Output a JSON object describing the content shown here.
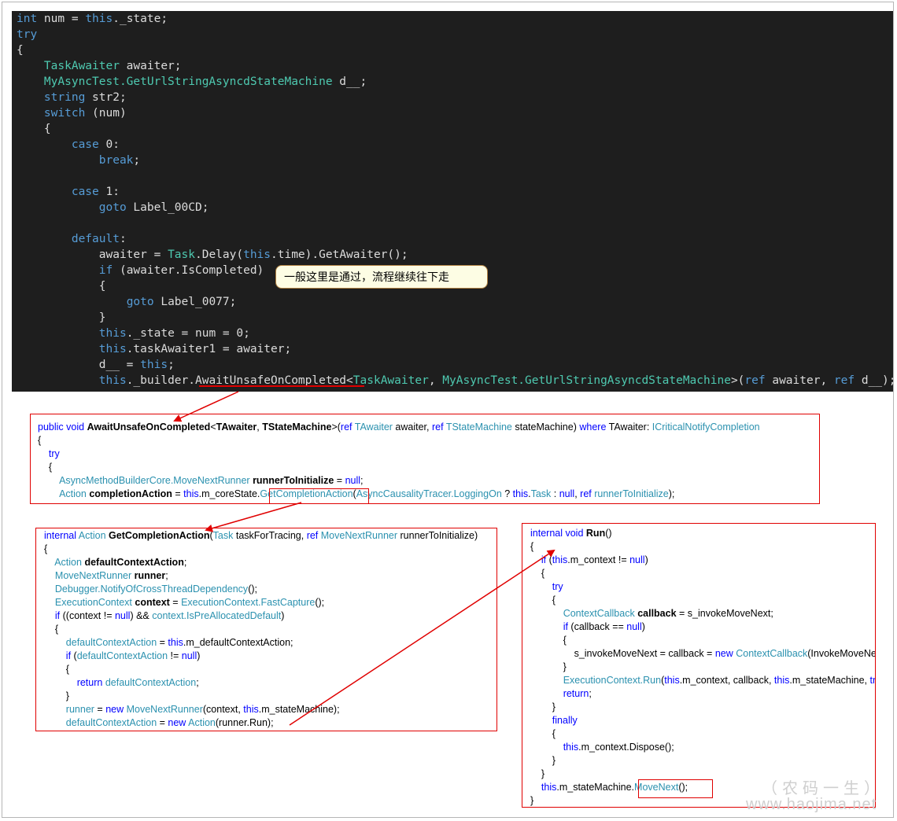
{
  "main_code": {
    "lines": [
      [
        {
          "t": "int",
          "c": "kw"
        },
        {
          "t": " num = "
        },
        {
          "t": "this",
          "c": "kw"
        },
        {
          "t": "._state;"
        }
      ],
      [
        {
          "t": "try",
          "c": "kw"
        }
      ],
      [
        {
          "t": "{"
        }
      ],
      [
        {
          "t": "    "
        },
        {
          "t": "TaskAwaiter",
          "c": "ty"
        },
        {
          "t": " awaiter;"
        }
      ],
      [
        {
          "t": "    "
        },
        {
          "t": "MyAsyncTest.GetUrlStringAsyncdStateMachine",
          "c": "ty"
        },
        {
          "t": " d__;"
        }
      ],
      [
        {
          "t": "    "
        },
        {
          "t": "string",
          "c": "kw"
        },
        {
          "t": " str2;"
        }
      ],
      [
        {
          "t": "    "
        },
        {
          "t": "switch",
          "c": "kw"
        },
        {
          "t": " (num)"
        }
      ],
      [
        {
          "t": "    {"
        }
      ],
      [
        {
          "t": "        "
        },
        {
          "t": "case",
          "c": "kw"
        },
        {
          "t": " 0:"
        }
      ],
      [
        {
          "t": "            "
        },
        {
          "t": "break",
          "c": "kw"
        },
        {
          "t": ";"
        }
      ],
      [
        {
          "t": ""
        }
      ],
      [
        {
          "t": "        "
        },
        {
          "t": "case",
          "c": "kw"
        },
        {
          "t": " 1:"
        }
      ],
      [
        {
          "t": "            "
        },
        {
          "t": "goto",
          "c": "kw"
        },
        {
          "t": " Label_00CD;"
        }
      ],
      [
        {
          "t": ""
        }
      ],
      [
        {
          "t": "        "
        },
        {
          "t": "default",
          "c": "kw"
        },
        {
          "t": ":"
        }
      ],
      [
        {
          "t": "            awaiter = "
        },
        {
          "t": "Task",
          "c": "ty"
        },
        {
          "t": ".Delay("
        },
        {
          "t": "this",
          "c": "kw"
        },
        {
          "t": ".time).GetAwaiter();"
        }
      ],
      [
        {
          "t": "            "
        },
        {
          "t": "if",
          "c": "kw"
        },
        {
          "t": " (awaiter.IsCompleted)"
        }
      ],
      [
        {
          "t": "            {"
        }
      ],
      [
        {
          "t": "                "
        },
        {
          "t": "goto",
          "c": "kw"
        },
        {
          "t": " Label_0077;"
        }
      ],
      [
        {
          "t": "            }"
        }
      ],
      [
        {
          "t": "            "
        },
        {
          "t": "this",
          "c": "kw"
        },
        {
          "t": "._state = num = 0;"
        }
      ],
      [
        {
          "t": "            "
        },
        {
          "t": "this",
          "c": "kw"
        },
        {
          "t": ".taskAwaiter1 = awaiter;"
        }
      ],
      [
        {
          "t": "            d__ = "
        },
        {
          "t": "this",
          "c": "kw"
        },
        {
          "t": ";"
        }
      ],
      [
        {
          "t": "            "
        },
        {
          "t": "this",
          "c": "kw"
        },
        {
          "t": "._builder.AwaitUnsafeOnCompleted<"
        },
        {
          "t": "TaskAwaiter",
          "c": "ty"
        },
        {
          "t": ", "
        },
        {
          "t": "MyAsyncTest.GetUrlStringAsyncdStateMachine",
          "c": "ty"
        },
        {
          "t": ">("
        },
        {
          "t": "ref",
          "c": "kw"
        },
        {
          "t": " awaiter, "
        },
        {
          "t": "ref",
          "c": "kw"
        },
        {
          "t": " d__);"
        }
      ]
    ]
  },
  "callout": {
    "text": "一般这里是通过，流程继续往下走"
  },
  "box_await": {
    "lines": [
      [
        {
          "t": "public",
          "c": "k"
        },
        {
          "t": " "
        },
        {
          "t": "void",
          "c": "k"
        },
        {
          "t": " "
        },
        {
          "t": "AwaitUnsafeOnCompleted",
          "c": "b"
        },
        {
          "t": "<"
        },
        {
          "t": "TAwaiter",
          "c": "b"
        },
        {
          "t": ", "
        },
        {
          "t": "TStateMachine",
          "c": "b"
        },
        {
          "t": ">("
        },
        {
          "t": "ref",
          "c": "k"
        },
        {
          "t": " "
        },
        {
          "t": "TAwaiter",
          "c": "t"
        },
        {
          "t": " awaiter, "
        },
        {
          "t": "ref",
          "c": "k"
        },
        {
          "t": " "
        },
        {
          "t": "TStateMachine",
          "c": "t"
        },
        {
          "t": " stateMachine) "
        },
        {
          "t": "where",
          "c": "k"
        },
        {
          "t": " TAwaiter: "
        },
        {
          "t": "ICriticalNotifyCompletion",
          "c": "t"
        }
      ],
      [
        {
          "t": "{"
        }
      ],
      [
        {
          "t": "    "
        },
        {
          "t": "try",
          "c": "k"
        }
      ],
      [
        {
          "t": "    {"
        }
      ],
      [
        {
          "t": "        "
        },
        {
          "t": "AsyncMethodBuilderCore.MoveNextRunner",
          "c": "t"
        },
        {
          "t": " "
        },
        {
          "t": "runnerToInitialize",
          "c": "b"
        },
        {
          "t": " = "
        },
        {
          "t": "null",
          "c": "k"
        },
        {
          "t": ";"
        }
      ],
      [
        {
          "t": "        "
        },
        {
          "t": "Action",
          "c": "t"
        },
        {
          "t": " "
        },
        {
          "t": "completionAction",
          "c": "b"
        },
        {
          "t": " = "
        },
        {
          "t": "this",
          "c": "k"
        },
        {
          "t": ".m_coreState."
        },
        {
          "t": "GetCompletionAction",
          "c": "t"
        },
        {
          "t": "("
        },
        {
          "t": "AsyncCausalityTracer.LoggingOn",
          "c": "t"
        },
        {
          "t": " ? "
        },
        {
          "t": "this",
          "c": "k"
        },
        {
          "t": "."
        },
        {
          "t": "Task",
          "c": "t"
        },
        {
          "t": " : "
        },
        {
          "t": "null",
          "c": "k"
        },
        {
          "t": ", "
        },
        {
          "t": "ref",
          "c": "k"
        },
        {
          "t": " "
        },
        {
          "t": "runnerToInitialize",
          "c": "t"
        },
        {
          "t": ");"
        }
      ]
    ]
  },
  "box_getcompletion": {
    "lines": [
      [
        {
          "t": "internal",
          "c": "k"
        },
        {
          "t": " "
        },
        {
          "t": "Action",
          "c": "t"
        },
        {
          "t": " "
        },
        {
          "t": "GetCompletionAction",
          "c": "b"
        },
        {
          "t": "("
        },
        {
          "t": "Task",
          "c": "t"
        },
        {
          "t": " taskForTracing, "
        },
        {
          "t": "ref",
          "c": "k"
        },
        {
          "t": " "
        },
        {
          "t": "MoveNextRunner",
          "c": "t"
        },
        {
          "t": " runnerToInitialize)"
        }
      ],
      [
        {
          "t": "{"
        }
      ],
      [
        {
          "t": "    "
        },
        {
          "t": "Action",
          "c": "t"
        },
        {
          "t": " "
        },
        {
          "t": "defaultContextAction",
          "c": "b"
        },
        {
          "t": ";"
        }
      ],
      [
        {
          "t": "    "
        },
        {
          "t": "MoveNextRunner",
          "c": "t"
        },
        {
          "t": " "
        },
        {
          "t": "runner",
          "c": "b"
        },
        {
          "t": ";"
        }
      ],
      [
        {
          "t": "    "
        },
        {
          "t": "Debugger.NotifyOfCrossThreadDependency",
          "c": "t"
        },
        {
          "t": "();"
        }
      ],
      [
        {
          "t": "    "
        },
        {
          "t": "ExecutionContext",
          "c": "t"
        },
        {
          "t": " "
        },
        {
          "t": "context",
          "c": "b"
        },
        {
          "t": " = "
        },
        {
          "t": "ExecutionContext.FastCapture",
          "c": "t"
        },
        {
          "t": "();"
        }
      ],
      [
        {
          "t": "    "
        },
        {
          "t": "if",
          "c": "k"
        },
        {
          "t": " ((context != "
        },
        {
          "t": "null",
          "c": "k"
        },
        {
          "t": ") && "
        },
        {
          "t": "context.IsPreAllocatedDefault",
          "c": "t"
        },
        {
          "t": ")"
        }
      ],
      [
        {
          "t": "    {"
        }
      ],
      [
        {
          "t": "        "
        },
        {
          "t": "defaultContextAction",
          "c": "t"
        },
        {
          "t": " = "
        },
        {
          "t": "this",
          "c": "k"
        },
        {
          "t": ".m_defaultContextAction;"
        }
      ],
      [
        {
          "t": "        "
        },
        {
          "t": "if",
          "c": "k"
        },
        {
          "t": " ("
        },
        {
          "t": "defaultContextAction",
          "c": "t"
        },
        {
          "t": " != "
        },
        {
          "t": "null",
          "c": "k"
        },
        {
          "t": ")"
        }
      ],
      [
        {
          "t": "        {"
        }
      ],
      [
        {
          "t": "            "
        },
        {
          "t": "return",
          "c": "k"
        },
        {
          "t": " "
        },
        {
          "t": "defaultContextAction",
          "c": "t"
        },
        {
          "t": ";"
        }
      ],
      [
        {
          "t": "        }"
        }
      ],
      [
        {
          "t": "        "
        },
        {
          "t": "runner",
          "c": "t"
        },
        {
          "t": " = "
        },
        {
          "t": "new",
          "c": "k"
        },
        {
          "t": " "
        },
        {
          "t": "MoveNextRunner",
          "c": "t"
        },
        {
          "t": "(context, "
        },
        {
          "t": "this",
          "c": "k"
        },
        {
          "t": ".m_stateMachine);"
        }
      ],
      [
        {
          "t": "        "
        },
        {
          "t": "defaultContextAction",
          "c": "t"
        },
        {
          "t": " = "
        },
        {
          "t": "new",
          "c": "k"
        },
        {
          "t": " "
        },
        {
          "t": "Action",
          "c": "t"
        },
        {
          "t": "(runner.Run);"
        }
      ]
    ]
  },
  "box_run": {
    "lines": [
      [
        {
          "t": "internal",
          "c": "k"
        },
        {
          "t": " "
        },
        {
          "t": "void",
          "c": "k"
        },
        {
          "t": " "
        },
        {
          "t": "Run",
          "c": "b"
        },
        {
          "t": "()"
        }
      ],
      [
        {
          "t": "{"
        }
      ],
      [
        {
          "t": "    "
        },
        {
          "t": "if",
          "c": "k"
        },
        {
          "t": " ("
        },
        {
          "t": "this",
          "c": "k"
        },
        {
          "t": ".m_context != "
        },
        {
          "t": "null",
          "c": "k"
        },
        {
          "t": ")"
        }
      ],
      [
        {
          "t": "    {"
        }
      ],
      [
        {
          "t": "        "
        },
        {
          "t": "try",
          "c": "k"
        }
      ],
      [
        {
          "t": "        {"
        }
      ],
      [
        {
          "t": "            "
        },
        {
          "t": "ContextCallback",
          "c": "t"
        },
        {
          "t": " "
        },
        {
          "t": "callback",
          "c": "b"
        },
        {
          "t": " = s_invokeMoveNext;"
        }
      ],
      [
        {
          "t": "            "
        },
        {
          "t": "if",
          "c": "k"
        },
        {
          "t": " (callback == "
        },
        {
          "t": "null",
          "c": "k"
        },
        {
          "t": ")"
        }
      ],
      [
        {
          "t": "            {"
        }
      ],
      [
        {
          "t": "                s_invokeMoveNext = callback = "
        },
        {
          "t": "new",
          "c": "k"
        },
        {
          "t": " "
        },
        {
          "t": "ContextCallback",
          "c": "t"
        },
        {
          "t": "(InvokeMoveNext);"
        }
      ],
      [
        {
          "t": "            }"
        }
      ],
      [
        {
          "t": "            "
        },
        {
          "t": "ExecutionContext.Run",
          "c": "t"
        },
        {
          "t": "("
        },
        {
          "t": "this",
          "c": "k"
        },
        {
          "t": ".m_context, callback, "
        },
        {
          "t": "this",
          "c": "k"
        },
        {
          "t": ".m_stateMachine, "
        },
        {
          "t": "true",
          "c": "k"
        },
        {
          "t": ");"
        }
      ],
      [
        {
          "t": "            "
        },
        {
          "t": "return",
          "c": "k"
        },
        {
          "t": ";"
        }
      ],
      [
        {
          "t": "        }"
        }
      ],
      [
        {
          "t": "        "
        },
        {
          "t": "finally",
          "c": "k"
        }
      ],
      [
        {
          "t": "        {"
        }
      ],
      [
        {
          "t": "            "
        },
        {
          "t": "this",
          "c": "k"
        },
        {
          "t": ".m_context.Dispose();"
        }
      ],
      [
        {
          "t": "        }"
        }
      ],
      [
        {
          "t": "    }"
        }
      ],
      [
        {
          "t": "    "
        },
        {
          "t": "this",
          "c": "k"
        },
        {
          "t": ".m_stateMachine."
        },
        {
          "t": "MoveNext",
          "c": "t"
        },
        {
          "t": "();"
        }
      ],
      [
        {
          "t": "}"
        }
      ]
    ]
  },
  "watermark": {
    "line1": "（农码一生）",
    "line2": "www.haojima.net"
  },
  "colors": {
    "dark_bg": "#1e1e1e",
    "keyword": "#569cd6",
    "type": "#4ec9b0",
    "highlight": "#e00000",
    "callout_bg": "#fdfde4"
  }
}
